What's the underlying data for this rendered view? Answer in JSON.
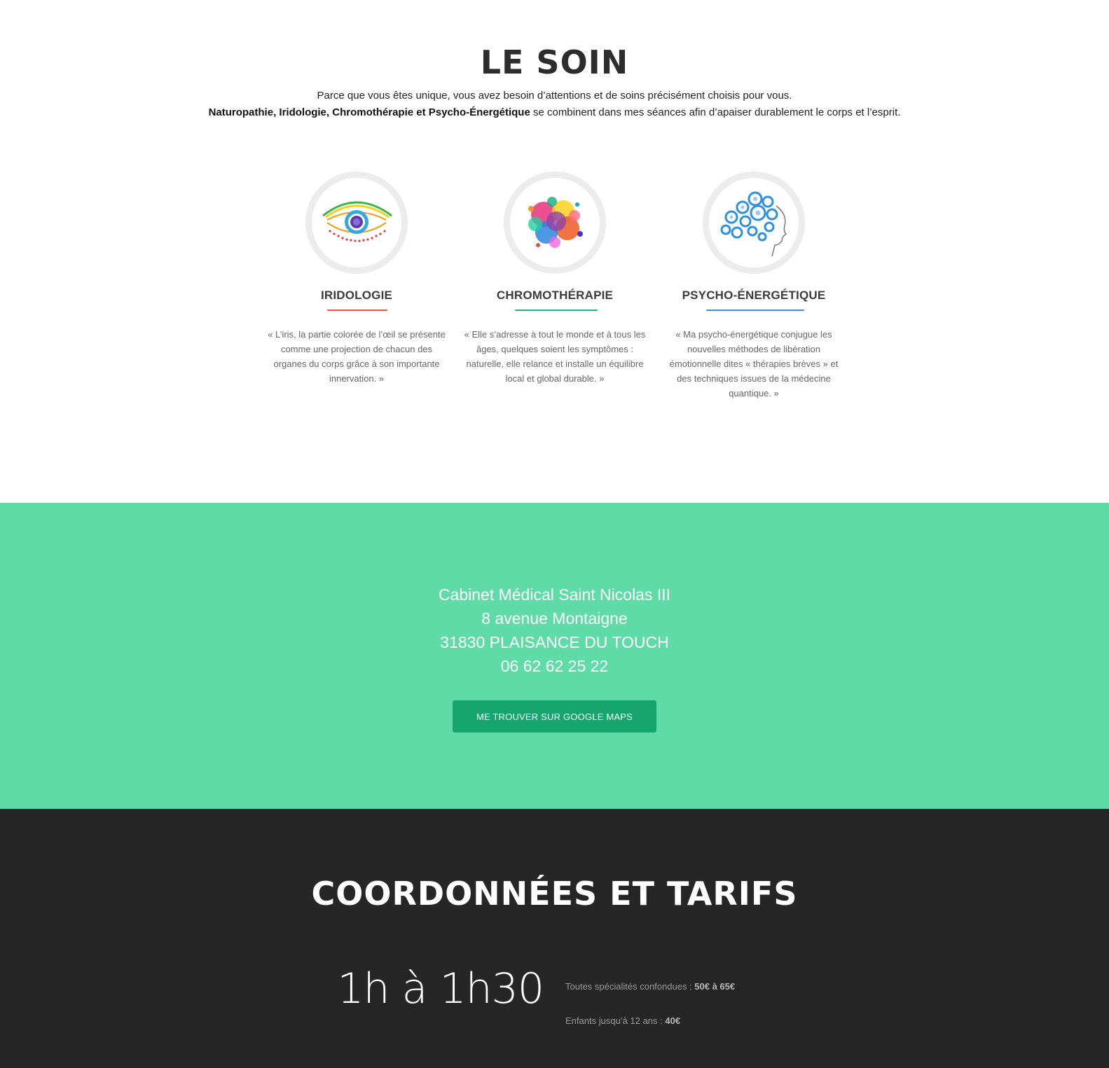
{
  "soin": {
    "title": "LE SOIN",
    "intro_line1": "Parce que vous êtes unique, vous avez besoin d’attentions et de soins précisément choisis pour vous.",
    "intro_line2_bold": "Naturopathie, Iridologie, Chromothérapie et Psycho-Énergétique",
    "intro_line2_rest": " se combinent dans mes séances afin d’apaiser durablement le corps et l’esprit.",
    "cards": [
      {
        "title": "IRIDOLOGIE",
        "icon": "eye-iris-icon",
        "accent": "#e8553f",
        "text": "« L’iris, la partie colorée de l’œil se présente comme une projection de chacun des organes du corps grâce à son importante innervation. »"
      },
      {
        "title": "CHROMOTHÉRAPIE",
        "icon": "color-splash-icon",
        "accent": "#22b07d",
        "text": "« Elle s’adresse à tout le monde et à tous les âges, quelques soient les symptômes : naturelle, elle relance et installe un équilibre local et global durable. »"
      },
      {
        "title": "PSYCHO-ÉNERGÉTIQUE",
        "icon": "gears-head-icon",
        "accent": "#3a8fd6",
        "text": "« Ma psycho-énergétique conjugue les nouvelles méthodes de libération émotionnelle dites « thérapies brèves » et des techniques issues de la médecine quantique. »"
      }
    ]
  },
  "address": {
    "line1": "Cabinet Médical Saint Nicolas III",
    "line2": "8 avenue Montaigne",
    "line3": "31830 PLAISANCE DU TOUCH",
    "phone": "06 62 62 25 22",
    "maps_button": "ME TROUVER SUR GOOGLE MAPS",
    "background": "#5fdba7",
    "button_color": "#15a56d"
  },
  "coords": {
    "title": "COORDONNÉES ET TARIFS",
    "duration": "1h à 1h30",
    "price1_label": "Toutes spécialités confondues : ",
    "price1_value": "50€ à 65€",
    "price2_label": "Enfants jusqu’à 12 ans : ",
    "price2_value": "40€",
    "background": "#262626"
  }
}
